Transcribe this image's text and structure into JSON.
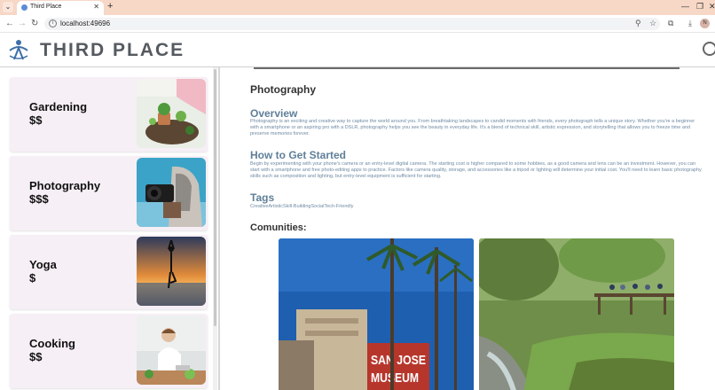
{
  "browser": {
    "tab_title": "Third Place",
    "url": "localhost:49696",
    "profile_initial": "N"
  },
  "app": {
    "brand": "THIRD PLACE"
  },
  "sidebar": {
    "items": [
      {
        "title": "Gardening",
        "price": "$$"
      },
      {
        "title": "Photography",
        "price": "$$$"
      },
      {
        "title": "Yoga",
        "price": "$"
      },
      {
        "title": "Cooking",
        "price": "$$"
      }
    ]
  },
  "main": {
    "title": "Photography",
    "overview_heading": "Overview",
    "overview_text": "Photography is an exciting and creative way to capture the world around you. From breathtaking landscapes to candid moments with friends, every photograph tells a unique story. Whether you're a beginner with a smartphone or an aspiring pro with a DSLR, photography helps you see the beauty in everyday life. It's a blend of technical skill, artistic expression, and storytelling that allows you to freeze time and preserve memories forever.",
    "getstarted_heading": "How to Get Started",
    "getstarted_text": "Begin by experimenting with your phone's camera or an entry-level digital camera. The starting cost is higher compared to some hobbies, as a good camera and lens can be an investment. However, you can start with a smartphone and free photo-editing apps to practice. Factors like camera quality, storage, and accessories like a tripod or lighting will determine your initial cost. You'll need to learn basic photography skills such as composition and lighting, but entry-level equipment is sufficient for starting.",
    "tags_heading": "Tags",
    "tags_text": "CreativeArtisticSkill-BuildingSocialTech-Friendly",
    "communities_heading": "Comunities:",
    "sign_text": "SAN JOSE MUSEUM"
  },
  "colors": {
    "card_bg": "#f6eff5",
    "heading_blue": "#5f7f99",
    "brand_gray": "#555a60"
  },
  "icons": [
    "menu-chevron-icon",
    "favicon-icon",
    "close-icon",
    "plus-icon",
    "back-icon",
    "forward-icon",
    "reload-icon",
    "site-info-icon",
    "zoom-icon",
    "bookmark-star-icon",
    "extensions-icon",
    "download-icon",
    "kebab-menu-icon",
    "logo-icon",
    "search-icon"
  ]
}
